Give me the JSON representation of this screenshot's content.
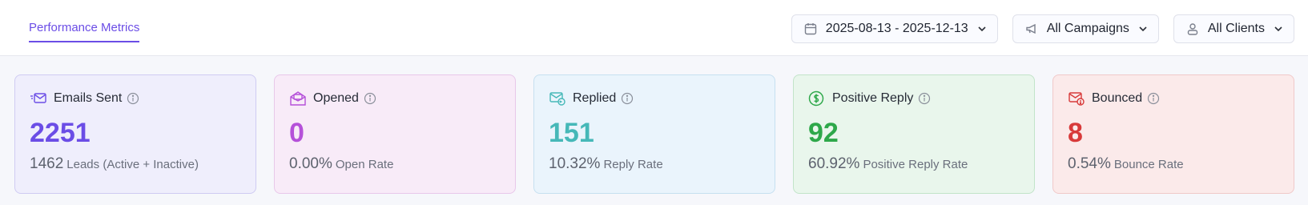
{
  "header": {
    "tab_label": "Performance Metrics",
    "filters": {
      "date_range": "2025-08-13 - 2025-12-13",
      "campaigns": "All Campaigns",
      "clients": "All Clients"
    }
  },
  "colors": {
    "accent": "#6b4de6"
  },
  "cards": [
    {
      "title": "Emails Sent",
      "icon": "mail-send-icon",
      "value": "2251",
      "sub_value": "1462",
      "sub_label": "Leads (Active + Inactive)",
      "color": "#6b4de6",
      "bg": "#efeefc",
      "border": "#cfcbf2"
    },
    {
      "title": "Opened",
      "icon": "mail-open-icon",
      "value": "0",
      "sub_value": "0.00%",
      "sub_label": "Open Rate",
      "color": "#b551d9",
      "bg": "#f8ebf8",
      "border": "#e8c8ea"
    },
    {
      "title": "Replied",
      "icon": "mail-reply-icon",
      "value": "151",
      "sub_value": "10.32%",
      "sub_label": "Reply Rate",
      "color": "#46b8b8",
      "bg": "#eaf4fc",
      "border": "#c6e0f0"
    },
    {
      "title": "Positive Reply",
      "icon": "dollar-circle-icon",
      "value": "92",
      "sub_value": "60.92%",
      "sub_label": "Positive Reply Rate",
      "color": "#2ea84a",
      "bg": "#e9f6ec",
      "border": "#c2e4c9"
    },
    {
      "title": "Bounced",
      "icon": "mail-bounce-icon",
      "value": "8",
      "sub_value": "0.54%",
      "sub_label": "Bounce Rate",
      "color": "#d83a3a",
      "bg": "#fbeaea",
      "border": "#f0c9c9"
    }
  ]
}
